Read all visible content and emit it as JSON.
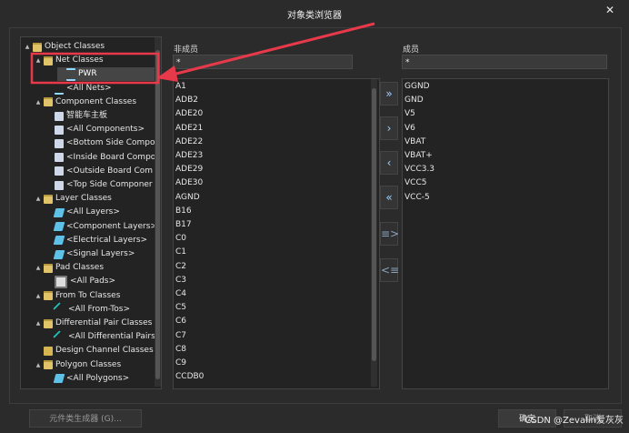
{
  "window": {
    "title": "对象类浏览器",
    "close_label": "✕"
  },
  "tree": {
    "items": [
      {
        "label": "Object Classes",
        "arrow": "▲",
        "icon": "folder-open-icon",
        "kind": "folder open",
        "indent": 0
      },
      {
        "label": "Net Classes",
        "arrow": "▲",
        "icon": "folder-open-icon",
        "kind": "folder open",
        "indent": 1
      },
      {
        "label": "PWR",
        "arrow": "",
        "icon": "net-class-icon",
        "kind": "net",
        "indent": 2,
        "selected": true
      },
      {
        "label": "<All Nets>",
        "arrow": "",
        "icon": "net-class-icon",
        "kind": "net",
        "indent": 2
      },
      {
        "label": "Component Classes",
        "arrow": "▲",
        "icon": "folder-open-icon",
        "kind": "folder open",
        "indent": 1
      },
      {
        "label": "智能车主板",
        "arrow": "",
        "icon": "component-icon",
        "kind": "comp",
        "indent": 2
      },
      {
        "label": "<All Components>",
        "arrow": "",
        "icon": "component-icon",
        "kind": "comp",
        "indent": 2
      },
      {
        "label": "<Bottom Side Compo",
        "arrow": "",
        "icon": "component-icon",
        "kind": "comp",
        "indent": 2
      },
      {
        "label": "<Inside Board Compo",
        "arrow": "",
        "icon": "component-icon",
        "kind": "comp",
        "indent": 2
      },
      {
        "label": "<Outside Board Com",
        "arrow": "",
        "icon": "component-icon",
        "kind": "comp",
        "indent": 2
      },
      {
        "label": "<Top Side Componer",
        "arrow": "",
        "icon": "component-icon",
        "kind": "comp",
        "indent": 2
      },
      {
        "label": "Layer Classes",
        "arrow": "▲",
        "icon": "folder-open-icon",
        "kind": "folder open",
        "indent": 1
      },
      {
        "label": "<All Layers>",
        "arrow": "",
        "icon": "layer-icon",
        "kind": "layer",
        "indent": 2
      },
      {
        "label": "<Component Layers>",
        "arrow": "",
        "icon": "layer-icon",
        "kind": "layer",
        "indent": 2
      },
      {
        "label": "<Electrical Layers>",
        "arrow": "",
        "icon": "layer-icon",
        "kind": "layer",
        "indent": 2
      },
      {
        "label": "<Signal Layers>",
        "arrow": "",
        "icon": "layer-icon",
        "kind": "layer",
        "indent": 2
      },
      {
        "label": "Pad Classes",
        "arrow": "▲",
        "icon": "folder-open-icon",
        "kind": "folder open",
        "indent": 1
      },
      {
        "label": "<All Pads>",
        "arrow": "",
        "icon": "pad-icon",
        "kind": "pad",
        "indent": 2
      },
      {
        "label": "From To Classes",
        "arrow": "▲",
        "icon": "folder-open-icon",
        "kind": "folder open",
        "indent": 1
      },
      {
        "label": "<All From-Tos>",
        "arrow": "",
        "icon": "from-to-icon",
        "kind": "fromto",
        "indent": 2
      },
      {
        "label": "Differential Pair Classes",
        "arrow": "▲",
        "icon": "folder-open-icon",
        "kind": "folder open",
        "indent": 1
      },
      {
        "label": "<All Differential Pairs:",
        "arrow": "",
        "icon": "from-to-icon",
        "kind": "fromto",
        "indent": 2
      },
      {
        "label": "Design Channel Classes",
        "arrow": "",
        "icon": "folder-icon",
        "kind": "folder",
        "indent": 1
      },
      {
        "label": "Polygon Classes",
        "arrow": "▲",
        "icon": "folder-open-icon",
        "kind": "folder open",
        "indent": 1
      },
      {
        "label": "<All Polygons>",
        "arrow": "",
        "icon": "layer-icon",
        "kind": "layer",
        "indent": 2
      }
    ]
  },
  "non_members": {
    "header": "非成员",
    "filter": "*",
    "items": [
      "A1",
      "ADB2",
      "ADE20",
      "ADE21",
      "ADE22",
      "ADE23",
      "ADE29",
      "ADE30",
      "AGND",
      "B16",
      "B17",
      "C0",
      "C1",
      "C2",
      "C3",
      "C4",
      "C5",
      "C6",
      "C7",
      "C8",
      "C9",
      "CCDB0"
    ]
  },
  "members": {
    "header": "成员",
    "filter": "*",
    "items": [
      "GGND",
      "GND",
      "V5",
      "V6",
      "VBAT",
      "VBAT+",
      "VCC3.3",
      "VCC5",
      "VCC-5"
    ]
  },
  "transfer_buttons": [
    {
      "name": "add-all-button",
      "label": "»"
    },
    {
      "name": "add-selected-button",
      "label": "›"
    },
    {
      "name": "remove-selected-button",
      "label": "‹"
    },
    {
      "name": "remove-all-button",
      "label": "«"
    },
    {
      "name": "add-filtered-button",
      "label": "≡>"
    },
    {
      "name": "remove-filtered-button",
      "label": "<≡"
    }
  ],
  "footer": {
    "generator_button": "元件类生成器 (G)...",
    "ok_button": "确定",
    "cancel_button": "取消",
    "watermark": "CSDN @Zevalin爱灰灰"
  },
  "colors": {
    "annotation": "#e8394b",
    "background": "#2b2b2b"
  }
}
